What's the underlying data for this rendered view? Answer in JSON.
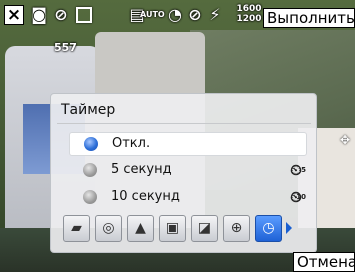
{
  "statusbar": {
    "close_icon": "×",
    "camera_icon": "◙",
    "noflash_icon": "⊘",
    "wb_icon": "▤",
    "awb_text": "AUTO",
    "timer_icon": "◔",
    "nolimit_icon": "⊘",
    "stab_icon": "⚡",
    "resolution_top": "1600",
    "resolution_bottom": "1200",
    "execute_label": "Выполнить"
  },
  "shot_counter": "557",
  "timer_panel": {
    "title": "Таймер",
    "options": [
      {
        "label": "Откл.",
        "selected": true,
        "icon": ""
      },
      {
        "label": "5 секунд",
        "selected": false,
        "icon": "timer-5-icon"
      },
      {
        "label": "10 секунд",
        "selected": false,
        "icon": "timer-10-icon"
      }
    ],
    "icon_5_sub": "5",
    "icon_10_sub": "10"
  },
  "toolbar": {
    "tools": [
      {
        "name": "camera-mode-icon",
        "glyph": "📷"
      },
      {
        "name": "focus-icon",
        "glyph": "◎"
      },
      {
        "name": "scene-mountain-icon",
        "glyph": "▲"
      },
      {
        "name": "frame-icon",
        "glyph": "▣"
      },
      {
        "name": "brightness-icon",
        "glyph": "◪"
      },
      {
        "name": "zoom-icon",
        "glyph": "🔍"
      },
      {
        "name": "timer-icon",
        "glyph": "⏱"
      }
    ],
    "selected_index": 6
  },
  "cancel_label": "Отмена",
  "colors": {
    "selection_blue": "#1f62d6"
  }
}
